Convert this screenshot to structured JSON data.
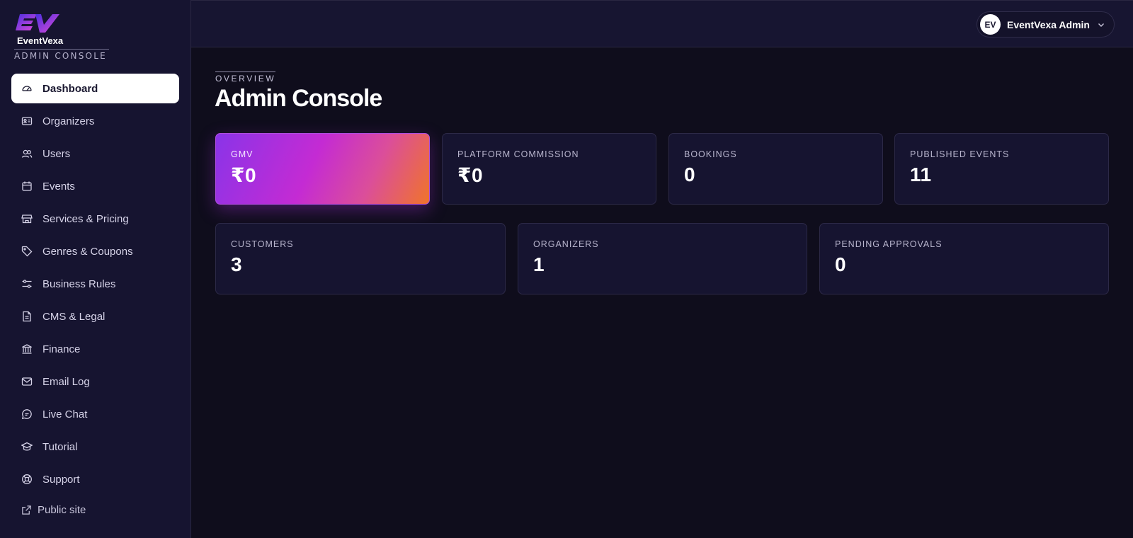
{
  "brand": {
    "name": "EventVexa",
    "subtitle": "ADMIN CONSOLE",
    "gradient_start": "#6a3df0",
    "gradient_end": "#d43fd8"
  },
  "sidebar": {
    "items": [
      {
        "label": "Dashboard",
        "icon": "gauge-icon",
        "active": true
      },
      {
        "label": "Organizers",
        "icon": "id-card-icon"
      },
      {
        "label": "Users",
        "icon": "users-icon"
      },
      {
        "label": "Events",
        "icon": "calendar-icon"
      },
      {
        "label": "Services & Pricing",
        "icon": "store-icon"
      },
      {
        "label": "Genres & Coupons",
        "icon": "tag-icon"
      },
      {
        "label": "Business Rules",
        "icon": "sliders-icon"
      },
      {
        "label": "CMS & Legal",
        "icon": "document-icon"
      },
      {
        "label": "Finance",
        "icon": "bank-icon"
      },
      {
        "label": "Email Log",
        "icon": "mail-icon"
      },
      {
        "label": "Live Chat",
        "icon": "chat-icon"
      },
      {
        "label": "Tutorial",
        "icon": "graduation-cap-icon"
      },
      {
        "label": "Support",
        "icon": "lifebuoy-icon"
      }
    ],
    "public_site": {
      "label": "Public site",
      "icon": "external-link-icon"
    }
  },
  "header": {
    "user": {
      "initials": "EV",
      "name": "EventVexa Admin",
      "icon": "chevron-down-icon"
    }
  },
  "main": {
    "eyebrow": "OVERVIEW",
    "title": "Admin Console",
    "stats_row1": [
      {
        "label": "GMV",
        "value": "₹0"
      },
      {
        "label": "PLATFORM COMMISSION",
        "value": "₹0"
      },
      {
        "label": "BOOKINGS",
        "value": "0"
      },
      {
        "label": "PUBLISHED EVENTS",
        "value": "11"
      }
    ],
    "stats_row2": [
      {
        "label": "CUSTOMERS",
        "value": "3"
      },
      {
        "label": "ORGANIZERS",
        "value": "1"
      },
      {
        "label": "PENDING APPROVALS",
        "value": "0"
      }
    ]
  },
  "colors": {
    "background": "#0f0d1c",
    "sidebar": "#161430",
    "card": "#161430",
    "hero_gradient": [
      "#8a34e8",
      "#c42bd3",
      "#db4e9a",
      "#f0742a"
    ]
  }
}
